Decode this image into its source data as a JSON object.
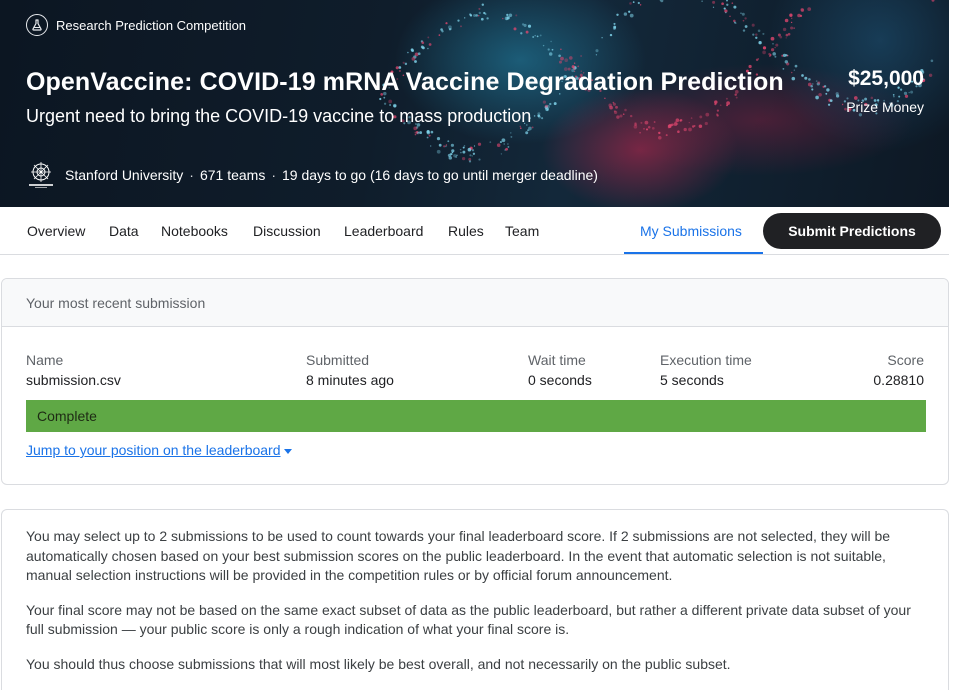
{
  "hero": {
    "competition_type": "Research Prediction Competition",
    "title": "OpenVaccine: COVID-19 mRNA Vaccine Degradation Prediction",
    "subtitle": "Urgent need to bring the COVID-19 vaccine to mass production",
    "prize_amount": "$25,000",
    "prize_label": "Prize Money",
    "host": "Stanford University",
    "teams": "671 teams",
    "deadline": "19 days to go (16 days to go until merger deadline)",
    "type_icon": "flask-icon",
    "host_logo": "stanford-openvaccine-logo"
  },
  "nav": {
    "tabs": [
      "Overview",
      "Data",
      "Notebooks",
      "Discussion",
      "Leaderboard",
      "Rules",
      "Team"
    ],
    "active_tab": "My Submissions",
    "submit_label": "Submit Predictions",
    "accent_color": "#1a73e8"
  },
  "recent_submission": {
    "header": "Your most recent submission",
    "columns": {
      "name": {
        "label": "Name",
        "value": "submission.csv"
      },
      "submitted": {
        "label": "Submitted",
        "value": "8 minutes ago"
      },
      "wait": {
        "label": "Wait time",
        "value": "0 seconds"
      },
      "exec": {
        "label": "Execution time",
        "value": "5 seconds"
      },
      "score": {
        "label": "Score",
        "value": "0.28810"
      }
    },
    "status": "Complete",
    "status_color": "#5fa845",
    "jump_link": "Jump to your position on the leaderboard"
  },
  "info": {
    "paragraphs": [
      "You may select up to 2 submissions to be used to count towards your final leaderboard score. If 2 submissions are not selected, they will be automatically chosen based on your best submission scores on the public leaderboard. In the event that automatic selection is not suitable, manual selection instructions will be provided in the competition rules or by official forum announcement.",
      "Your final score may not be based on the same exact subset of data as the public leaderboard, but rather a different private data subset of your full submission — your public score is only a rough indication of what your final score is.",
      "You should thus choose submissions that will most likely be best overall, and not necessarily on the public subset."
    ]
  }
}
